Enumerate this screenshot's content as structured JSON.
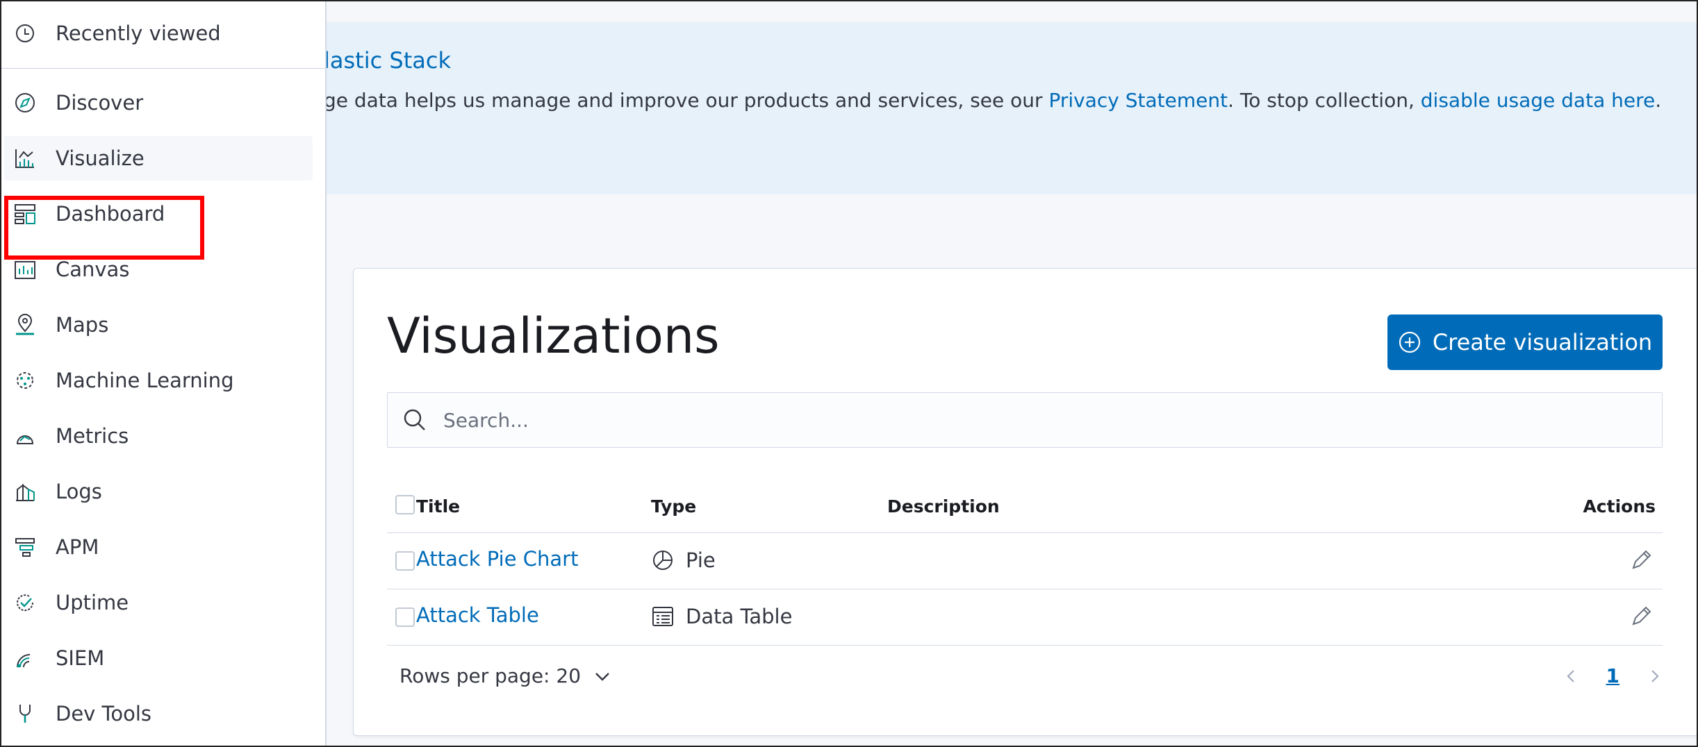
{
  "banner": {
    "title": "lastic Stack",
    "text_prefix": "ge data helps us manage and improve our products and services, see our ",
    "privacy_link": "Privacy Statement",
    "text_middle": ". To stop collection, ",
    "disable_link": "disable usage data here",
    "text_suffix": "."
  },
  "nav": {
    "recent": {
      "label": "Recently viewed",
      "icon": "clock-icon"
    },
    "items": [
      {
        "label": "Discover",
        "icon": "compass-icon"
      },
      {
        "label": "Visualize",
        "icon": "visualize-icon"
      },
      {
        "label": "Dashboard",
        "icon": "dashboard-icon"
      },
      {
        "label": "Canvas",
        "icon": "canvas-icon"
      },
      {
        "label": "Maps",
        "icon": "maps-icon"
      },
      {
        "label": "Machine Learning",
        "icon": "ml-icon"
      },
      {
        "label": "Metrics",
        "icon": "metrics-icon"
      },
      {
        "label": "Logs",
        "icon": "logs-icon"
      },
      {
        "label": "APM",
        "icon": "apm-icon"
      },
      {
        "label": "Uptime",
        "icon": "uptime-icon"
      },
      {
        "label": "SIEM",
        "icon": "siem-icon"
      },
      {
        "label": "Dev Tools",
        "icon": "devtools-icon"
      }
    ],
    "active": "Visualize",
    "highlighted": "Dashboard"
  },
  "main": {
    "title": "Visualizations",
    "create_button": "Create visualization",
    "search_placeholder": "Search...",
    "table": {
      "headers": {
        "title": "Title",
        "type": "Type",
        "description": "Description",
        "actions": "Actions"
      },
      "rows": [
        {
          "title": "Attack Pie Chart",
          "type": "Pie",
          "type_icon": "pie-chart-icon",
          "description": ""
        },
        {
          "title": "Attack Table",
          "type": "Data Table",
          "type_icon": "data-table-icon",
          "description": ""
        }
      ]
    },
    "pagination": {
      "rows_per_page": "Rows per page: 20",
      "current_page": "1"
    }
  },
  "colors": {
    "accent": "#006bb8",
    "banner_bg": "#e6f1fa",
    "highlight": "#ff0000",
    "icon_teal": "#00968c"
  }
}
